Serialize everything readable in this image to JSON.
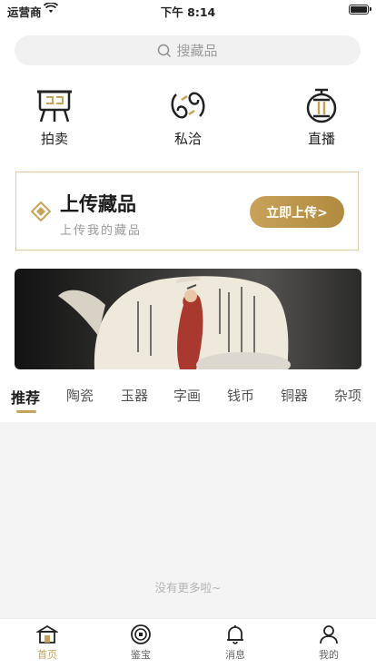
{
  "status_bar": {
    "carrier": "运营商",
    "time": "下午 8:14"
  },
  "search": {
    "placeholder": "搜藏品"
  },
  "quick_nav": [
    {
      "label": "拍卖",
      "icon": "auction-stand-icon"
    },
    {
      "label": "私洽",
      "icon": "handshake-icon"
    },
    {
      "label": "直播",
      "icon": "live-stream-icon"
    }
  ],
  "upload_card": {
    "title": "上传藏品",
    "subtitle": "上传我的藏品",
    "button_label": "立即上传>"
  },
  "category_tabs": [
    "推荐",
    "陶瓷",
    "玉器",
    "字画",
    "钱币",
    "铜器",
    "杂项"
  ],
  "active_category": "推荐",
  "feed": {
    "empty_text": "没有更多啦~"
  },
  "tab_bar": [
    {
      "label": "首页",
      "icon": "home-icon",
      "active": true
    },
    {
      "label": "鉴宝",
      "icon": "appraise-icon",
      "active": false
    },
    {
      "label": "消息",
      "icon": "bell-icon",
      "active": false
    },
    {
      "label": "我的",
      "icon": "profile-icon",
      "active": false
    }
  ],
  "colors": {
    "accent": "#c9a25a",
    "card_border": "#e6c9a7",
    "feed_bg": "#f4f4f4"
  }
}
